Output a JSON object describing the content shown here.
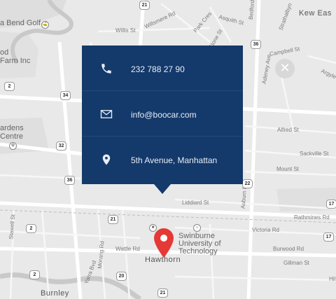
{
  "contact": {
    "phone": "232 788 27 90",
    "email": "info@boocar.com",
    "address": "5th Avenue, Manhattan"
  },
  "icons": {
    "phone": "phone-icon",
    "email": "mail-icon",
    "location": "location-pin-icon",
    "marker": "map-marker-icon",
    "close": "close-icon"
  },
  "colors": {
    "card_bg": "#14396b",
    "marker": "#e53935",
    "map_bg": "#e9e9e9"
  },
  "map": {
    "place_hawthorn": "Hawthorn",
    "place_burnley": "Burnley",
    "place_kew_east": "Kew Eas",
    "place_swinburne_1": "Swinburne",
    "place_swinburne_2": "University of",
    "place_swinburne_3": "Technology",
    "golf": "a Bend Golf",
    "farm_1": "od",
    "farm_2": "Farm Inc",
    "gardens_1": "ardens",
    "gardens_2": "Centre",
    "street_willis": "Willis St",
    "street_willsmere": "Willsmere Rd",
    "street_park_cres": "Park Cres",
    "street_asquith": "Asquith St",
    "street_bedford": "Bedford",
    "street_strathalbyn": "Strathalbyn",
    "street_campbell": "Campbell St",
    "street_adeney": "Adeney Ave",
    "street_argyle": "Argyle",
    "street_stone": "Stone St",
    "street_alfred": "Alfred St",
    "street_sackville": "Sackville St",
    "street_mount": "Mount St",
    "street_liddiard": "Liddiard St",
    "street_auburn": "Auburn Rd",
    "street_rathmines": "Rathmines Rd",
    "street_victoria": "Victoria Rd",
    "street_burwood": "Burwood Rd",
    "street_gillman": "Gillman St",
    "street_wattle": "Wattle Rd",
    "street_morang": "Morang Rd",
    "street_yarra": "Yarra Bvd",
    "street_stawell": "Stawell St",
    "street_hil": "Hil",
    "shield_21a": "21",
    "shield_21b": "21",
    "shield_21c": "21",
    "shield_34": "34",
    "shield_2a": "2",
    "shield_2b": "2",
    "shield_2c": "2",
    "shield_32": "32",
    "shield_36a": "36",
    "shield_36b": "36",
    "shield_17a": "17",
    "shield_17b": "17",
    "shield_20": "20",
    "shield_22": "22"
  }
}
